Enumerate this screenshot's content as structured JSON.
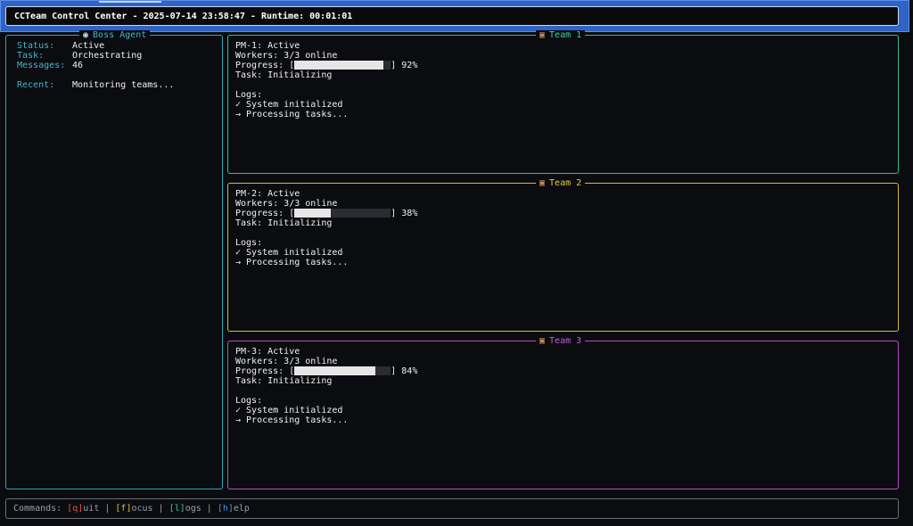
{
  "window": {
    "title": "CCTeam Control Center - 2025-07-14 23:58:47 - Runtime: 00:01:01"
  },
  "boss": {
    "icon": "robot-icon",
    "title": "Boss Agent",
    "status_label": "Status:",
    "status_value": "Active",
    "task_label": "Task:",
    "task_value": "Orchestrating",
    "messages_label": "Messages:",
    "messages_value": "46",
    "recent_label": "Recent:",
    "recent_value": "Monitoring teams..."
  },
  "teams": [
    {
      "title": "Team 1",
      "icon": "briefcase-icon",
      "color": "#33c089",
      "pm": "PM-1: Active",
      "workers": "Workers: 3/3 online",
      "progress_label": "Progress: [",
      "progress_percent": 92,
      "progress_text": "] 92%",
      "task": "Task: Initializing",
      "logs_label": "Logs:",
      "logs": [
        "✓ System initialized",
        "→ Processing tasks..."
      ]
    },
    {
      "title": "Team 2",
      "icon": "briefcase-icon",
      "color": "#d9b830",
      "pm": "PM-2: Active",
      "workers": "Workers: 3/3 online",
      "progress_label": "Progress: [",
      "progress_percent": 38,
      "progress_text": "] 38%",
      "task": "Task: Initializing",
      "logs_label": "Logs:",
      "logs": [
        "✓ System initialized",
        "→ Processing tasks..."
      ]
    },
    {
      "title": "Team 3",
      "icon": "briefcase-icon",
      "color": "#b64fc0",
      "pm": "PM-3: Active",
      "workers": "Workers: 3/3 online",
      "progress_label": "Progress: [",
      "progress_percent": 84,
      "progress_text": "] 84%",
      "task": "Task: Initializing",
      "logs_label": "Logs:",
      "logs": [
        "✓ System initialized",
        "→ Processing tasks..."
      ]
    }
  ],
  "commands": {
    "prefix": "Commands: ",
    "items": [
      {
        "key": "[q]",
        "rest": "uit",
        "color": "#e0533f"
      },
      {
        "key": "[f]",
        "rest": "ocus",
        "color": "#d9c23a"
      },
      {
        "key": "[l]",
        "rest": "ogs",
        "color": "#3fc38a"
      },
      {
        "key": "[h]",
        "rest": "elp",
        "color": "#4f8de8"
      }
    ],
    "separator": " | "
  }
}
